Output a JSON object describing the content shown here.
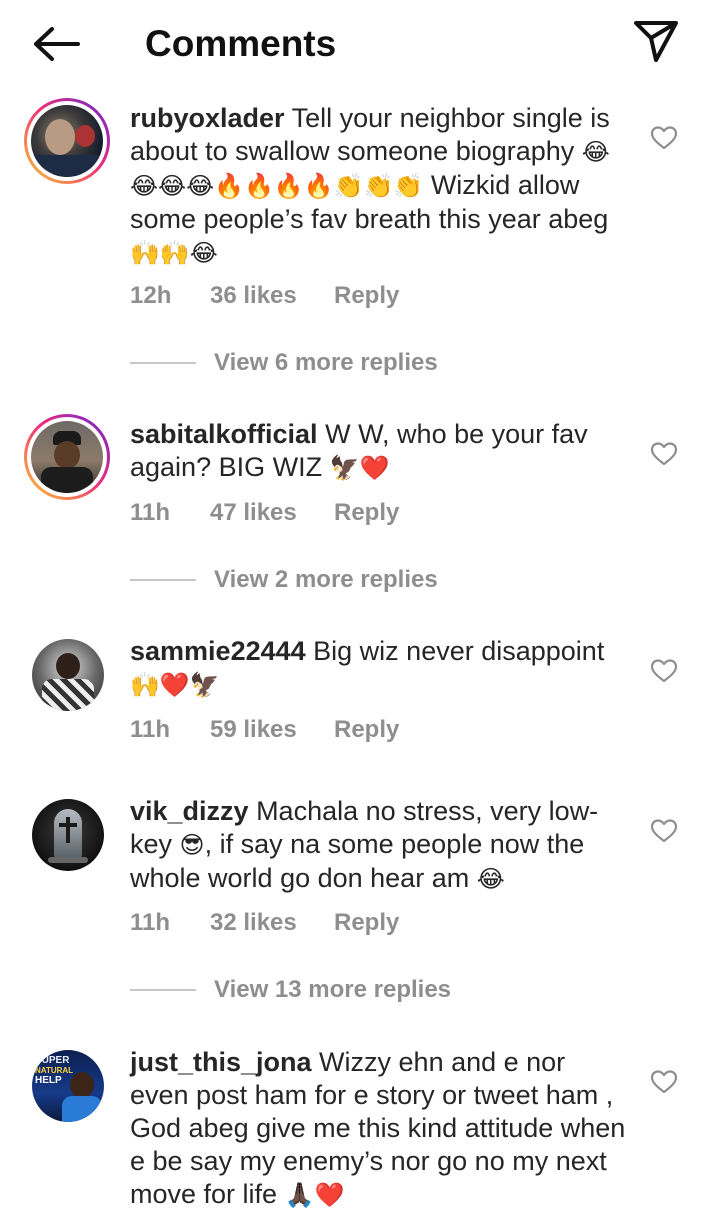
{
  "header": {
    "title": "Comments",
    "back_icon": "arrow-left-icon",
    "share_icon": "paper-plane-icon"
  },
  "colors": {
    "story_ring_start": "#f9ce34",
    "story_ring_mid": "#ee2a7b",
    "story_ring_end": "#6228d7",
    "meta_gray": "#8e8e8e"
  },
  "comments": [
    {
      "username": "rubyoxlader",
      "text": " Tell your neighbor single is about to swallow someone biography ",
      "emojis1": "😂😂😂😂🔥🔥🔥🔥👏👏👏",
      "text2": " Wizkid allow some people’s fav breath this year abeg ",
      "emojis2": "🙌🙌😂",
      "time": "12h",
      "likes": "36 likes",
      "reply": "Reply",
      "view_replies": "View 6 more replies"
    },
    {
      "username": "sabitalkofficial",
      "text": " W W, who be your fav again? BIG WIZ ",
      "emojis1": "🦅❤️",
      "time": "11h",
      "likes": "47 likes",
      "reply": "Reply",
      "view_replies": "View 2 more replies"
    },
    {
      "username": "sammie22444",
      "text": " Big wiz never disappoint ",
      "emojis1": "🙌❤️🦅",
      "time": "11h",
      "likes": "59 likes",
      "reply": "Reply"
    },
    {
      "username": "vik_dizzy",
      "text": " Machala no stress, very low-key ",
      "emojis1": "😎",
      "text2": ", if say na some people now the whole world go don hear am ",
      "emojis2": "😂",
      "time": "11h",
      "likes": "32 likes",
      "reply": "Reply",
      "view_replies": "View 13 more replies"
    },
    {
      "username": "just_this_jona",
      "text": " Wizzy ehn and e nor even post ham for e story or tweet ham , God abeg give me this kind attitude when e be say my enemy’s nor go no my next move for life ",
      "emojis1": "🙏🏿❤️",
      "avatar_text": [
        "SUPER",
        "NATURAL",
        "HELP"
      ]
    }
  ]
}
